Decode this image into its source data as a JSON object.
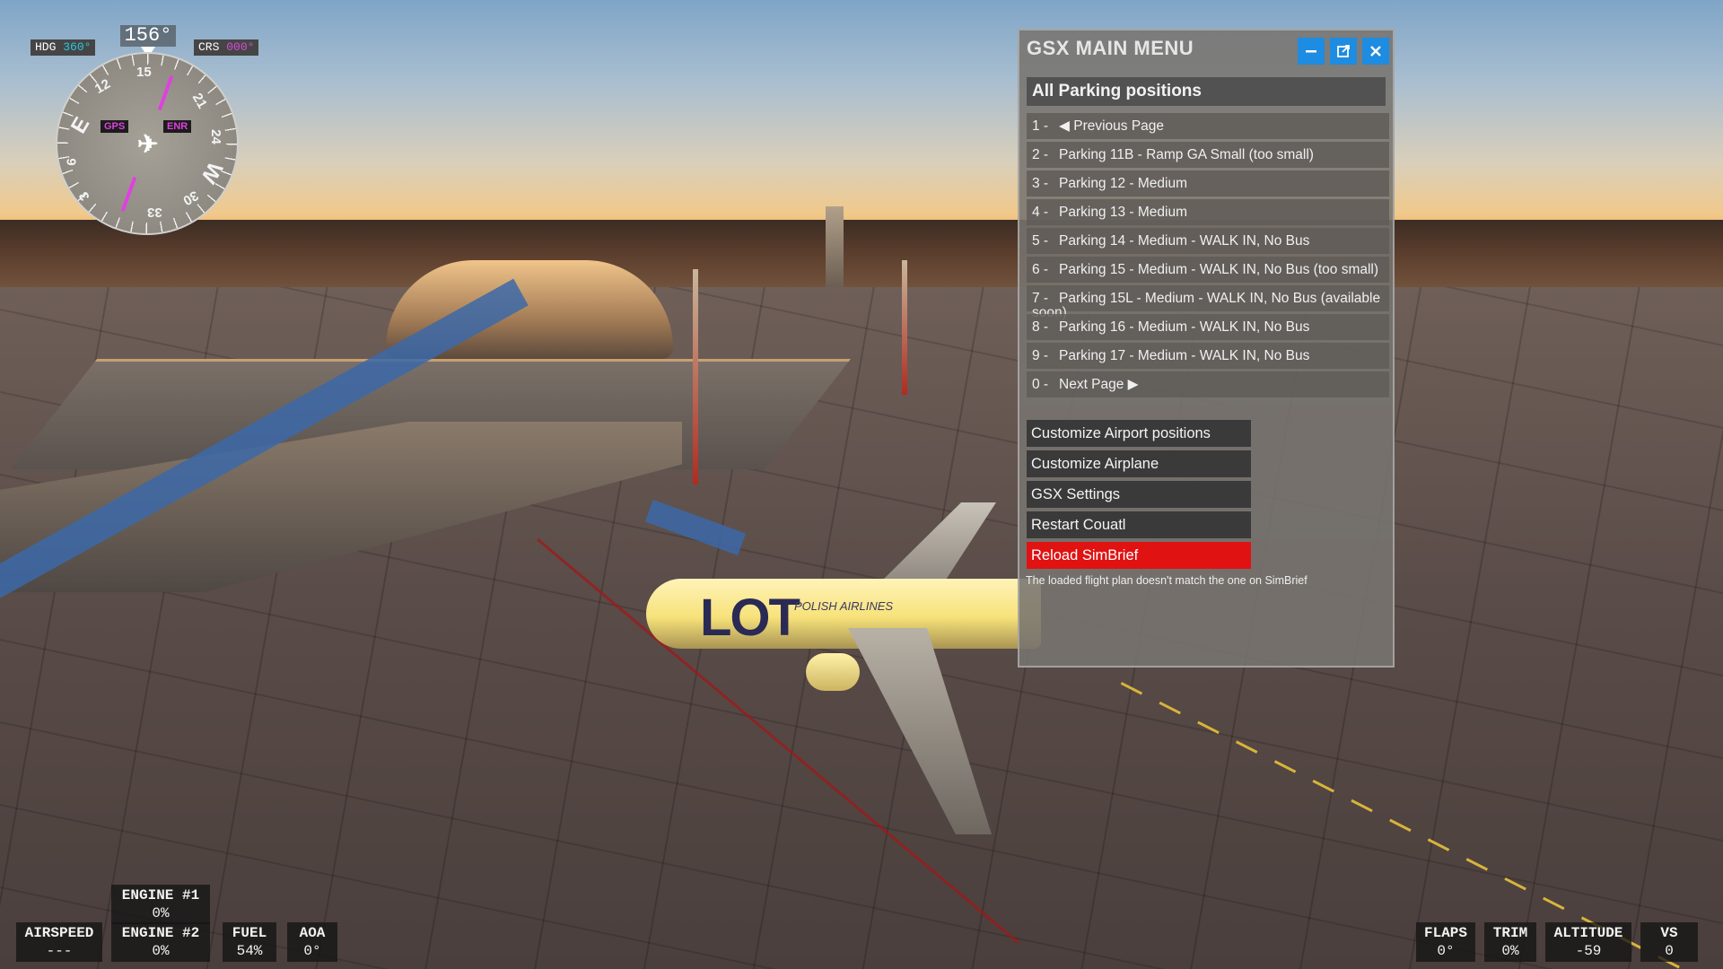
{
  "compass": {
    "heading_readout": "156°",
    "hdg_label": "HDG",
    "hdg_value": "360°",
    "crs_label": "CRS",
    "crs_value": "000°",
    "tags": {
      "gps": "GPS",
      "enr": "ENR"
    },
    "card_labels": {
      "n15": "15",
      "n12": "12",
      "e": "E",
      "n6": "6",
      "n3": "3",
      "n33": "33",
      "n30": "30",
      "w": "W",
      "n24": "24",
      "n21": "21"
    }
  },
  "gsx": {
    "title": "GSX MAIN MENU",
    "buttons": {
      "minimize": "minimize-icon",
      "popout": "popout-icon",
      "close": "close-icon"
    },
    "section": "All Parking positions",
    "items": [
      {
        "num": "1  -",
        "label": "◀ Previous Page"
      },
      {
        "num": "2  -",
        "label": "Parking 11B - Ramp GA Small (too small)"
      },
      {
        "num": "3  -",
        "label": "Parking 12 - Medium"
      },
      {
        "num": "4  -",
        "label": "Parking 13 - Medium"
      },
      {
        "num": "5  -",
        "label": "Parking 14 - Medium - WALK IN, No Bus"
      },
      {
        "num": "6  -",
        "label": "Parking 15 - Medium - WALK IN, No Bus (too small)"
      },
      {
        "num": "7  -",
        "label": "Parking 15L - Medium - WALK IN, No Bus (available",
        "overflow": "soon)"
      },
      {
        "num": "8  -",
        "label": "Parking 16 - Medium - WALK IN, No Bus"
      },
      {
        "num": "9  -",
        "label": "Parking 17 - Medium - WALK IN, No Bus"
      },
      {
        "num": "0  -",
        "label": "Next Page ▶"
      }
    ],
    "actions": [
      "Customize Airport positions",
      "Customize Airplane",
      "GSX Settings",
      "Restart Couatl",
      "Reload SimBrief"
    ],
    "warning": "The loaded flight plan doesn't match the one on SimBrief"
  },
  "hud": {
    "engine1": {
      "label": "ENGINE #1",
      "value": "0%"
    },
    "airspeed": {
      "label": "AIRSPEED",
      "value": "---"
    },
    "engine2": {
      "label": "ENGINE #2",
      "value": "0%"
    },
    "fuel": {
      "label": "FUEL",
      "value": "54%"
    },
    "aoa": {
      "label": "AOA",
      "value": "0°"
    },
    "flaps": {
      "label": "FLAPS",
      "value": "0°"
    },
    "trim": {
      "label": "TRIM",
      "value": "0%"
    },
    "altitude": {
      "label": "ALTITUDE",
      "value": "-59"
    },
    "vs": {
      "label": "VS",
      "value": "0"
    }
  },
  "scene": {
    "fuselage_logo": "LOT",
    "fuselage_text": "POLISH AIRLINES"
  },
  "colors": {
    "accent_blue": "#1e8ce0",
    "danger_red": "#e01212",
    "compass_magenta": "#d84ad8",
    "compass_cyan": "#29c7e0"
  }
}
